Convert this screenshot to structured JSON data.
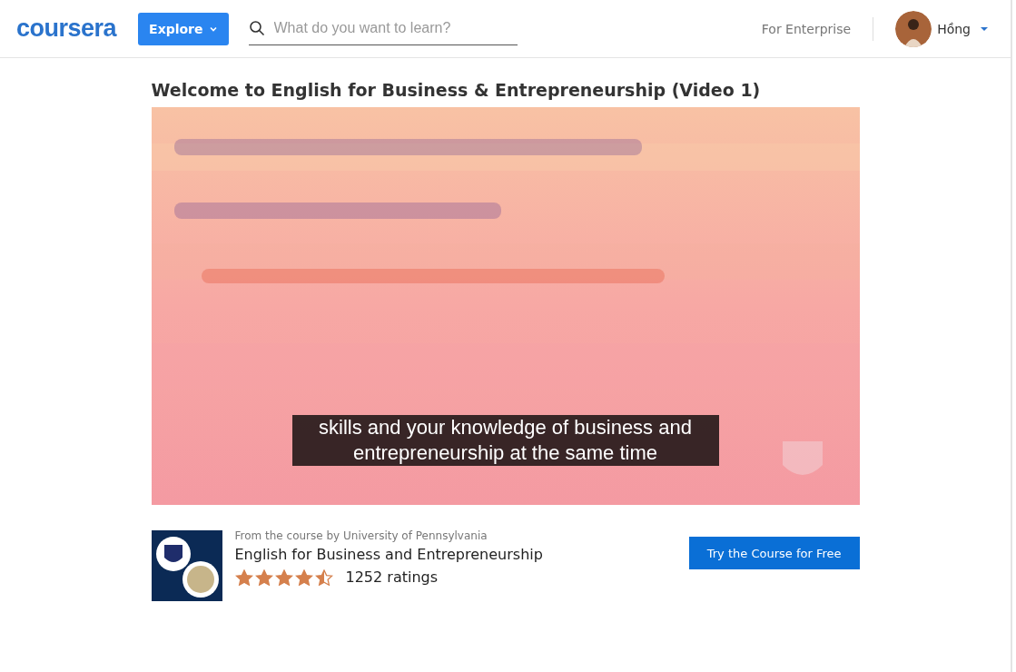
{
  "header": {
    "logo": "coursera",
    "explore_button": "Explore",
    "search": {
      "placeholder": "What do you want to learn?"
    },
    "enterprise_link": "For Enterprise",
    "user": {
      "name": "Hồng"
    }
  },
  "video": {
    "title": "Welcome to English for Business & Entrepreneurship (Video 1)",
    "kind": "picture",
    "caption": "skills and your knowledge of business and entrepreneurship at the same time"
  },
  "course": {
    "provider": "From the course by University of Pennsylvania",
    "name": "English for Business and Entrepreneurship",
    "stars": 4.5,
    "ratings": "1252 ratings",
    "cta": "Try the Course for Free"
  }
}
